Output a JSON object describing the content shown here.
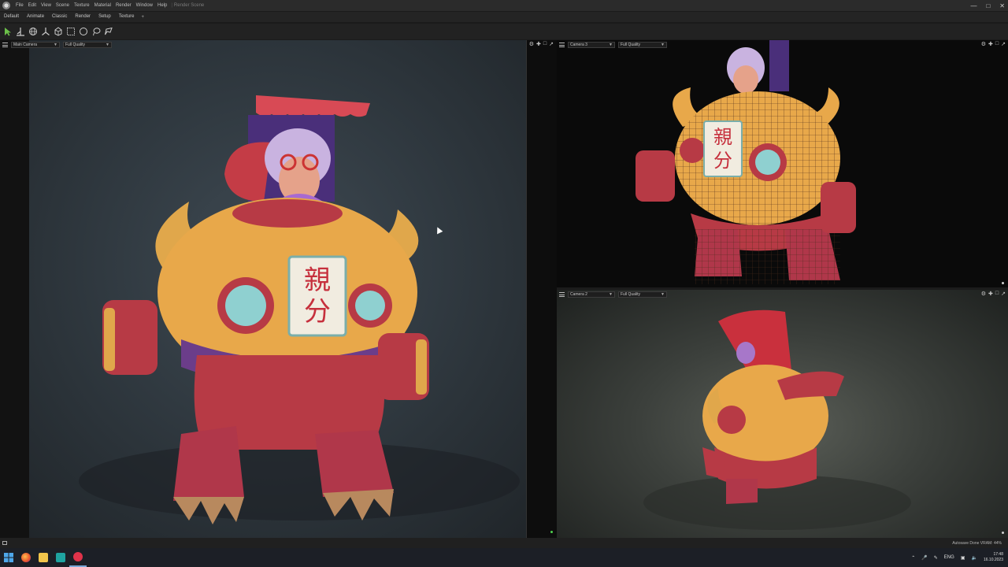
{
  "titlebar": {
    "menus": [
      "File",
      "Edit",
      "View",
      "Scene",
      "Texture",
      "Material",
      "Render",
      "Window",
      "Help"
    ],
    "title": "Render Scene"
  },
  "modes": {
    "tabs": [
      "Default",
      "Animate",
      "Classic",
      "Render",
      "Setup",
      "Texture"
    ],
    "add_label": "+"
  },
  "tools": [
    "select-arrow-icon",
    "transform-icon",
    "rotate-icon",
    "scale-icon",
    "pan-icon",
    "rect-select-icon",
    "circle-select-icon",
    "lasso-icon",
    "freehand-select-icon"
  ],
  "viewports": {
    "main": {
      "camera": "Main Camera",
      "quality": "Full Quality"
    },
    "top_right": {
      "camera": "Camera 3",
      "quality": "Full Quality"
    },
    "bottom_right": {
      "camera": "Camera 2",
      "quality": "Full Quality"
    }
  },
  "sign_text": {
    "line1": "親",
    "line2": "分"
  },
  "status": {
    "right": "Autosave Done  VRAM: 44%"
  },
  "taskbar": {
    "lang": "ENG",
    "time": "17:48",
    "date": "16.10.2023"
  },
  "colors": {
    "accent": "#7aa8d8",
    "robot_body": "#e8a84a",
    "robot_red": "#b73a45",
    "grandma_purple": "#a777c9",
    "window_glass": "#8fd0d0"
  }
}
